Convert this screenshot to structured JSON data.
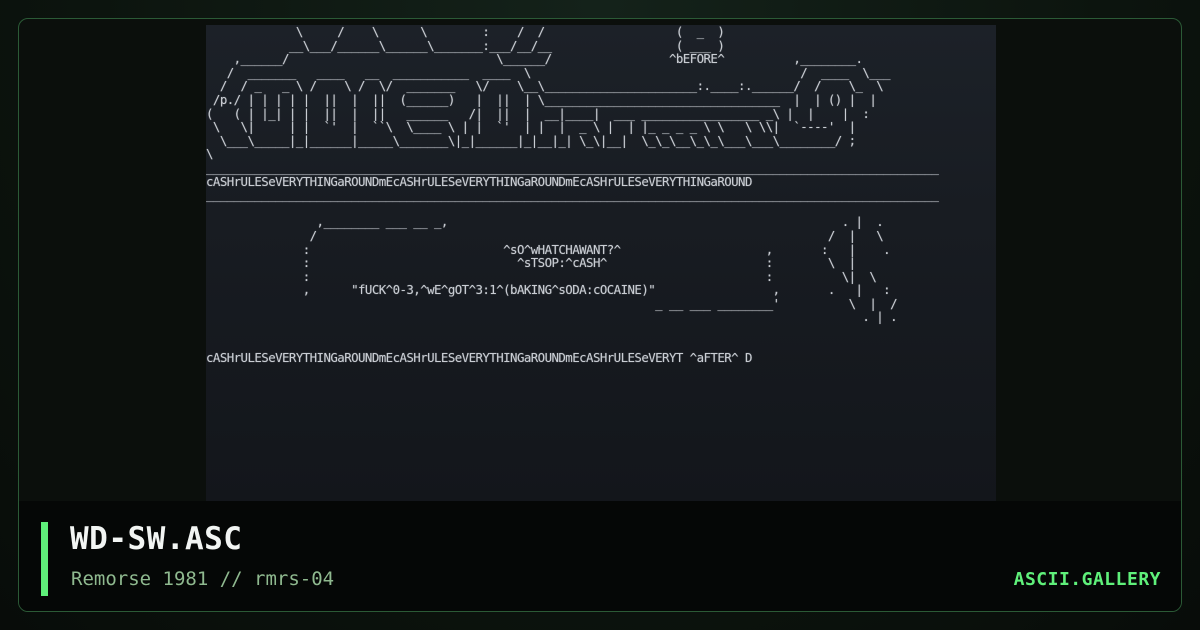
{
  "artwork": {
    "ascii": "             \\     /    \\      \\        :    /  /                   (  _  )\n            __\\___/______\\______\\_______:___/__/__                  ( ___ )\n    ,______/                              \\______/                 ^bEFORE^          ,________.\n   /  _______   ____   __  ___________  ____  \\                                       /  ____  \\___\n  /  / _   _ \\ /    \\ /  \\/  _______   \\/    \\__\\______________________:.____:.______/  /    \\_  \\\n /p./ | | | | |  ||  |  ||  (______)   |  ||  | \\__________________________________  |  | () |  |\n(   ( | |_| | |  ||  |  ||   ______   /|  ||  |  __|____|  ___ _________________ _\\ |  |    |  :\n \\   \\|     | |  `'  |  ``\\  \\____ \\ | |  `'  | |  |  _ \\ |  | |_ _ _ _ \\ \\   \\ \\\\|  `----'  |\n  \\___\\_____|_|______|_____\\_______\\|_|______|_|__|_| \\_\\|__|  \\_\\_\\__\\_\\_\\___\\___\\________/ ;\n\\\n__________________________________________________________________________________________________________\ncASHrULESeVERYTHINGaROUNDmEcASHrULESeVERYTHINGaROUNDmEcASHrULESeVERYTHINGaROUND\n__________________________________________________________________________________________________________\n\n                ,________ ___ __ _,                                                         . |  .\n               /                                                                          /  |   \\\n              :                            ^sO^wHATCHAWANT?^                     ,       :   |    .\n              :                              ^sTSOP:^cASH^                       :        \\  |\n              :                                                                  :          \\|  \\\n              ,      \"fUCK^0-3,^wE^gOT^3:1^(bAKING^sODA:cOCAINE)\"                 ,       .   |   :\n                                                                 _ __ ___ ________'          \\  |  /\n                                                                                               . | .\n\n\ncASHrULESeVERYTHINGaROUNDmEcASHrULESeVERYTHINGaROUNDmEcASHrULESeVERYT ^aFTER^ D"
  },
  "meta": {
    "title": "WD-SW.ASC",
    "subtitle": "Remorse 1981 // rmrs-04",
    "brand": "ASCII.GALLERY"
  },
  "colors": {
    "accent": "#5ff07a",
    "subtitle": "#8fb98f",
    "title": "#f2f5f3",
    "frame_border": "#2b5a36"
  }
}
